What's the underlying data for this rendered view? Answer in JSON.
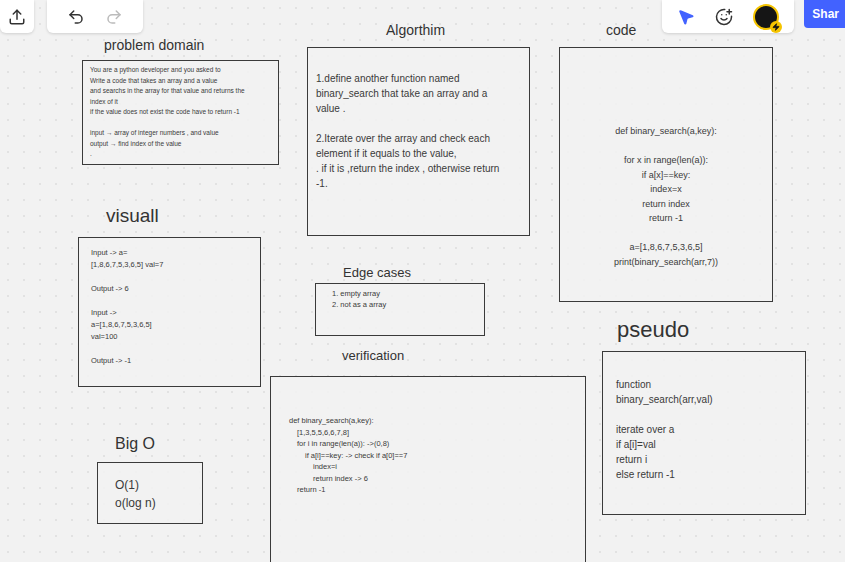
{
  "toolbar": {
    "share_button": "Shar"
  },
  "frames": [
    {
      "title": "problem domain",
      "lines": [
        "You are a python developer and you asked to",
        "Write a code that takes an array and a value",
        "and searchs in the array for that value and returns the",
        "index of it",
        "if the value does not exist the code have to return -1",
        "",
        "input → array of integer numbers , and value",
        "output → find index of the value",
        "."
      ]
    },
    {
      "title": "Algorthim",
      "lines": [
        "1.define another function named",
        "binary_search that take an array and a",
        "value .",
        "",
        "2.Iterate over the array and check each",
        "element if it equals to the value,",
        ". if it is ,return the index , otherwise return",
        "-1."
      ]
    },
    {
      "title": "code",
      "lines": [
        "def binary_search(a,key):",
        "",
        "for x in range(len(a)):",
        "if a[x]==key:",
        "index=x",
        "return index",
        "return -1",
        "",
        "a=[1,8,6,7,5,3,6,5]",
        "print(binary_search(arr,7))"
      ]
    },
    {
      "title": "visuall",
      "lines": [
        "Input -> a=",
        "[1,8,6,7,5,3,6,5] val=7",
        "",
        "Output -> 6",
        "",
        "Input ->",
        "a=[1,8,6,7,5,3,6,5]",
        "val=100",
        "",
        "Output -> -1"
      ]
    },
    {
      "title": "Edge cases",
      "lines": [
        "1. empty array",
        "2. not as a array"
      ]
    },
    {
      "title": "verification",
      "lines": [
        "def binary_search(a,key):",
        "[1,3,5,5,6,6,7,8]",
        "for i in range(len(a)): ->(0,8)",
        "if a[i]==key: -> check if a[0]==7",
        "index=i",
        "return index   -> 6",
        "return -1"
      ]
    },
    {
      "title": "pseudo",
      "lines": [
        "function",
        "binary_search(arr,val)",
        "",
        "iterate over a",
        "if a[i]=val",
        "return i",
        "else return -1"
      ]
    },
    {
      "title": "Big O",
      "lines": [
        "O(1)",
        "o(log n)"
      ]
    }
  ]
}
